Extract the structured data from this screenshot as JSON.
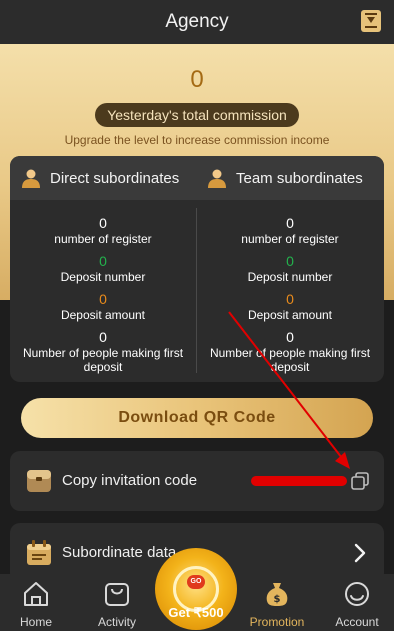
{
  "header": {
    "title": "Agency",
    "rules_icon": "rules-book-icon"
  },
  "hero": {
    "commission_value": "0",
    "commission_label": "Yesterday's total commission",
    "upgrade_text": "Upgrade the level to increase commission income"
  },
  "stats": {
    "direct": {
      "title": "Direct subordinates",
      "register_value": "0",
      "register_label": "number of register",
      "deposit_number_value": "0",
      "deposit_number_label": "Deposit number",
      "deposit_amount_value": "0",
      "deposit_amount_label": "Deposit amount",
      "first_deposit_value": "0",
      "first_deposit_label": "Number of people making first deposit"
    },
    "team": {
      "title": "Team subordinates",
      "register_value": "0",
      "register_label": "number of register",
      "deposit_number_value": "0",
      "deposit_number_label": "Deposit number",
      "deposit_amount_value": "0",
      "deposit_amount_label": "Deposit amount",
      "first_deposit_value": "0",
      "first_deposit_label": "Number of people making first deposit"
    }
  },
  "actions": {
    "download_qr": "Download QR Code",
    "copy_invitation": "Copy invitation code",
    "subordinate_data": "Subordinate data"
  },
  "wheel": {
    "badge": "GO",
    "label": "Get ₹500"
  },
  "nav": {
    "home": "Home",
    "activity": "Activity",
    "promotion": "Promotion",
    "account": "Account"
  },
  "colors": {
    "gold": "#e3b55d",
    "green": "#23b24d",
    "orange": "#e88b1c",
    "annotation_red": "#e10000"
  }
}
